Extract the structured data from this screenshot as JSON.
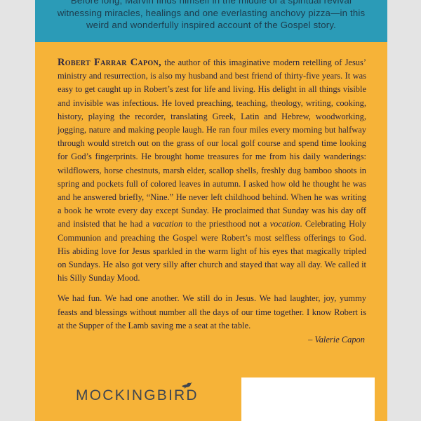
{
  "blurb": {
    "line1": "Before long, Marvin finds himself in the middle of a spiritual revival",
    "line2": "witnessing miracles, healings and one everlasting anchovy pizza—in this",
    "line3": "weird and wonderfully inspired account of the Gospel story."
  },
  "paragraph1": {
    "author_name": "Robert Farrar Capon,",
    "text_a": " the author of this imaginative modern retelling of Jesus’ ministry and resurrection, is also my husband and best friend of thirty-five years. It was easy to get caught up in Robert’s zest for life and living. His delight in all things visible and invisible was infectious. He loved preaching, teaching, theology, writing, cooking, history, playing the recorder, translating Greek, Latin and Hebrew, woodworking, jogging, nature and making people laugh. He ran four miles every morning but halfway through would stretch out on the grass of our local golf course and spend time looking for God’s fingerprints. He brought home treasures for me from his daily wanderings: wildflowers, horse chestnuts, marsh elder, scallop shells, freshly dug bamboo shoots in spring and pockets full of colored leaves in autumn. I asked how old he thought he was and he answered briefly, “Nine.” He never left childhood behind. When he was writing a book he wrote every day except Sunday. He proclaimed that Sunday was his day off and insisted that he had a ",
    "italic_1": "vacation",
    "text_b": " to the priesthood not a ",
    "italic_2": "vocation",
    "text_c": ". Celebrating Holy Communion and preaching the Gospel were Robert’s most selfless offerings to God. His abiding love for Jesus sparkled in the warm light of his eyes that magically tripled on Sundays. He also got very silly after church and stayed that way all day. We called it his Silly Sunday Mood."
  },
  "paragraph2": {
    "text": "We had fun. We had one another. We still do in Jesus. We had laughter, joy, yummy feasts and blessings without number all the days of our time together. I know Robert is at the Supper of the Lamb saving me a seat at the table."
  },
  "signature": "– Valerie Capon",
  "logo": {
    "text": "MOCKINGBIRD",
    "icon": "bird-icon"
  },
  "colors": {
    "cover_background": "#f6b338",
    "top_band": "#2b9bb7",
    "text": "#2b2540",
    "page_background": "#e4e4e4",
    "logo": "#3f4650"
  }
}
